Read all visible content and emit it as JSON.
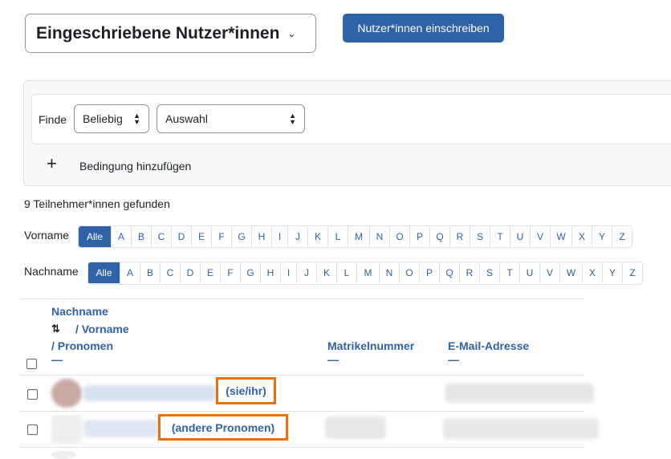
{
  "header": {
    "page_select": "Eingeschriebene Nutzer*innen",
    "enrol_button": "Nutzer*innen einschreiben"
  },
  "filter": {
    "label": "Finde",
    "match_select": "Beliebig",
    "type_select": "Auswahl",
    "add_condition": "Bedingung hinzufügen"
  },
  "participants_count": "9 Teilnehmer*innen gefunden",
  "initials": {
    "first_label": "Vorname",
    "last_label": "Nachname",
    "all": "Alle",
    "letters": [
      "A",
      "B",
      "C",
      "D",
      "E",
      "F",
      "G",
      "H",
      "I",
      "J",
      "K",
      "L",
      "M",
      "N",
      "O",
      "P",
      "Q",
      "R",
      "S",
      "T",
      "U",
      "V",
      "W",
      "X",
      "Y",
      "Z"
    ]
  },
  "table": {
    "col_lastname": "Nachname",
    "col_firstname": "/ Vorname",
    "col_pronouns": "/ Pronomen",
    "col_idnumber": "Matrikelnummer",
    "col_email": "E-Mail-Adresse",
    "dash": "—",
    "rows": [
      {
        "pronouns": "(sie/ihr)"
      },
      {
        "pronouns": "(andere Pronomen)"
      }
    ]
  },
  "icons": {
    "dropdown": "chevron-down-icon",
    "select_arrows": "updown-icon",
    "plus": "plus-icon",
    "sort": "sort-ascending-icon"
  },
  "colors": {
    "primary": "#2f63a8",
    "highlight": "#ef6f0f"
  }
}
